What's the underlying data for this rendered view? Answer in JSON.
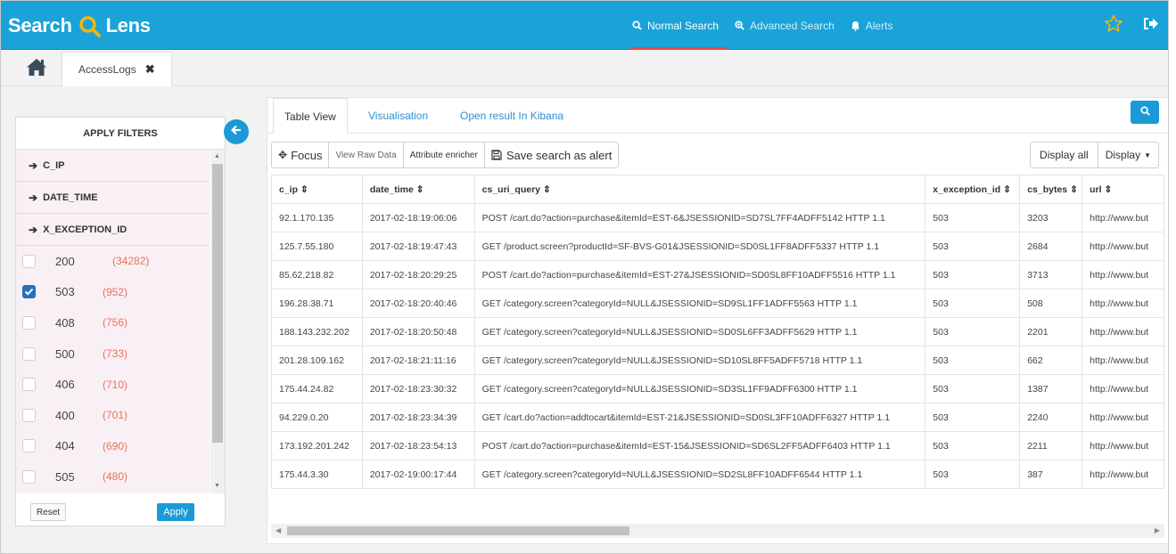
{
  "app": {
    "logo_word1": "Search",
    "logo_word2": "Lens",
    "accent": "#1aa3d8",
    "logo_accent": "#f5b50c"
  },
  "nav": [
    {
      "label": "Normal Search",
      "icon": "search-icon",
      "active": true
    },
    {
      "label": "Advanced Search",
      "icon": "search-plus-icon",
      "active": false
    },
    {
      "label": "Alerts",
      "icon": "bell-icon",
      "active": false
    }
  ],
  "tabbar": {
    "tab_label": "AccessLogs"
  },
  "filters": {
    "title": "APPLY FILTERS",
    "facets": [
      "C_IP",
      "DATE_TIME",
      "X_EXCEPTION_ID"
    ],
    "options": [
      {
        "code": "200",
        "count": "(34282)",
        "checked": false
      },
      {
        "code": "503",
        "count": "(952)",
        "checked": true
      },
      {
        "code": "408",
        "count": "(756)",
        "checked": false
      },
      {
        "code": "500",
        "count": "(733)",
        "checked": false
      },
      {
        "code": "406",
        "count": "(710)",
        "checked": false
      },
      {
        "code": "400",
        "count": "(701)",
        "checked": false
      },
      {
        "code": "404",
        "count": "(690)",
        "checked": false
      },
      {
        "code": "505",
        "count": "(480)",
        "checked": false
      }
    ],
    "reset_label": "Reset",
    "apply_label": "Apply"
  },
  "results": {
    "tabs": [
      "Table View",
      "Visualisation",
      "Open result In Kibana"
    ],
    "toolbar": {
      "focus": "Focus",
      "raw": "View Raw Data",
      "enricher": "Attribute enricher",
      "save_alert": "Save search as alert",
      "display_all": "Display all",
      "display": "Display"
    },
    "columns": [
      "c_ip",
      "date_time",
      "cs_uri_query",
      "x_exception_id",
      "cs_bytes",
      "url"
    ],
    "rows": [
      [
        "92.1.170.135",
        "2017-02-18:19:06:06",
        "POST /cart.do?action=purchase&itemId=EST-6&JSESSIONID=SD7SL7FF4ADFF5142 HTTP 1.1",
        "503",
        "3203",
        "http://www.but"
      ],
      [
        "125.7.55.180",
        "2017-02-18:19:47:43",
        "GET /product.screen?productId=SF-BVS-G01&JSESSIONID=SD0SL1FF8ADFF5337 HTTP 1.1",
        "503",
        "2684",
        "http://www.but"
      ],
      [
        "85.62.218.82",
        "2017-02-18:20:29:25",
        "POST /cart.do?action=purchase&itemId=EST-27&JSESSIONID=SD0SL8FF10ADFF5516 HTTP 1.1",
        "503",
        "3713",
        "http://www.but"
      ],
      [
        "196.28.38.71",
        "2017-02-18:20:40:46",
        "GET /category.screen?categoryId=NULL&JSESSIONID=SD9SL1FF1ADFF5563 HTTP 1.1",
        "503",
        "508",
        "http://www.but"
      ],
      [
        "188.143.232.202",
        "2017-02-18:20:50:48",
        "GET /category.screen?categoryId=NULL&JSESSIONID=SD0SL6FF3ADFF5629 HTTP 1.1",
        "503",
        "2201",
        "http://www.but"
      ],
      [
        "201.28.109.162",
        "2017-02-18:21:11:16",
        "GET /category.screen?categoryId=NULL&JSESSIONID=SD10SL8FF5ADFF5718 HTTP 1.1",
        "503",
        "662",
        "http://www.but"
      ],
      [
        "175.44.24.82",
        "2017-02-18:23:30:32",
        "GET /category.screen?categoryId=NULL&JSESSIONID=SD3SL1FF9ADFF6300 HTTP 1.1",
        "503",
        "1387",
        "http://www.but"
      ],
      [
        "94.229.0.20",
        "2017-02-18:23:34:39",
        "GET /cart.do?action=addtocart&itemId=EST-21&JSESSIONID=SD0SL3FF10ADFF6327 HTTP 1.1",
        "503",
        "2240",
        "http://www.but"
      ],
      [
        "173.192.201.242",
        "2017-02-18:23:54:13",
        "POST /cart.do?action=purchase&itemId=EST-15&JSESSIONID=SD6SL2FF5ADFF6403 HTTP 1.1",
        "503",
        "2211",
        "http://www.but"
      ],
      [
        "175.44.3.30",
        "2017-02-19:00:17:44",
        "GET /category.screen?categoryId=NULL&JSESSIONID=SD2SL8FF10ADFF6544 HTTP 1.1",
        "503",
        "387",
        "http://www.but"
      ]
    ]
  }
}
